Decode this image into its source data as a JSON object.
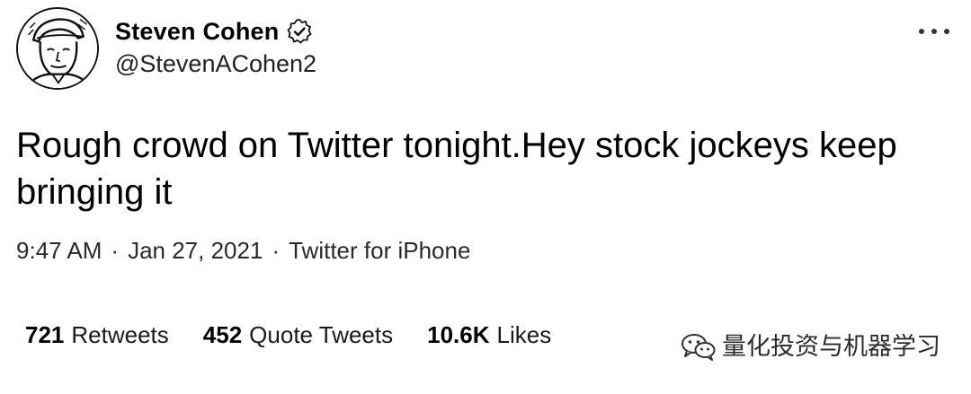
{
  "author": {
    "display_name": "Steven Cohen",
    "handle": "@StevenACohen2",
    "avatar_icon": "avatar-sketch-icon",
    "verified_icon": "verified-badge-icon"
  },
  "tweet": {
    "text": "Rough crowd on Twitter tonight.Hey stock jockeys keep bringing it"
  },
  "meta": {
    "time": "9:47 AM",
    "separator": "·",
    "date": "Jan 27, 2021",
    "source": "Twitter for iPhone"
  },
  "stats": {
    "retweets": {
      "count": "721",
      "label": "Retweets"
    },
    "quote_tweets": {
      "count": "452",
      "label": "Quote Tweets"
    },
    "likes": {
      "count": "10.6K",
      "label": "Likes"
    }
  },
  "more_icon": "more-dots-icon",
  "watermark": {
    "icon": "wechat-icon",
    "text": "量化投资与机器学习"
  },
  "colors": {
    "text": "#000000",
    "secondary": "#2a2a2a",
    "background": "#ffffff"
  }
}
